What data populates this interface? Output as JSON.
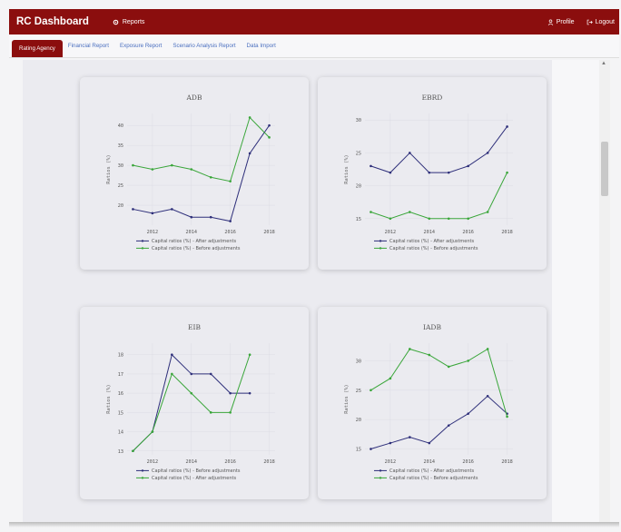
{
  "navbar": {
    "brand": "RC Dashboard",
    "reports_label": "Reports",
    "profile_label": "Profile",
    "logout_label": "Logout"
  },
  "tabs": [
    {
      "label": "Rating Agency",
      "active": true
    },
    {
      "label": "Financial Report",
      "active": false
    },
    {
      "label": "Exposure Report",
      "active": false
    },
    {
      "label": "Scenario Analysis Report",
      "active": false
    },
    {
      "label": "Data Import",
      "active": false
    }
  ],
  "colors": {
    "brand": "#8b0e0e",
    "series_dark": "#2e2f7a",
    "series_green": "#3aa63a",
    "tab_link": "#4a6fbf"
  },
  "chart_data": [
    {
      "type": "line",
      "title": "ADB",
      "ylabel": "Ratios (%)",
      "x": [
        2011,
        2012,
        2013,
        2014,
        2015,
        2016,
        2017,
        2018
      ],
      "xticks": [
        2012,
        2014,
        2016,
        2018
      ],
      "yticks": [
        20,
        25,
        30,
        35,
        40
      ],
      "ylim": [
        15,
        43
      ],
      "xlim": [
        2010.7,
        2018.3
      ],
      "series": [
        {
          "name": "Capital ratios (%) - After adjustments",
          "color": "#2e2f7a",
          "values": [
            19,
            18,
            19,
            17,
            17,
            16,
            33,
            40
          ]
        },
        {
          "name": "Capital ratios (%) - Before adjustments",
          "color": "#3aa63a",
          "values": [
            30,
            29,
            30,
            29,
            27,
            26,
            42,
            37
          ]
        }
      ]
    },
    {
      "type": "line",
      "title": "EBRD",
      "ylabel": "Ratios (%)",
      "x": [
        2011,
        2012,
        2013,
        2014,
        2015,
        2016,
        2017,
        2018
      ],
      "xticks": [
        2012,
        2014,
        2016,
        2018
      ],
      "yticks": [
        15,
        20,
        25,
        30
      ],
      "ylim": [
        14,
        31
      ],
      "xlim": [
        2010.7,
        2018.3
      ],
      "series": [
        {
          "name": "Capital ratios (%) - After adjustments",
          "color": "#2e2f7a",
          "values": [
            23,
            22,
            25,
            22,
            22,
            23,
            25,
            29
          ]
        },
        {
          "name": "Capital ratios (%) - Before adjustments",
          "color": "#3aa63a",
          "values": [
            16,
            15,
            16,
            15,
            15,
            15,
            16,
            22
          ]
        }
      ]
    },
    {
      "type": "line",
      "title": "EIB",
      "ylabel": "Ratios (%)",
      "x": [
        2011,
        2012,
        2013,
        2014,
        2015,
        2016,
        2017
      ],
      "xticks": [
        2012,
        2014,
        2016,
        2018
      ],
      "yticks": [
        13,
        14,
        15,
        16,
        17,
        18
      ],
      "ylim": [
        12.8,
        18.6
      ],
      "xlim": [
        2010.7,
        2018.3
      ],
      "series": [
        {
          "name": "Capital ratios (%) - Before adjustments",
          "color": "#2e2f7a",
          "values": [
            13,
            14,
            18,
            17,
            17,
            16,
            16
          ]
        },
        {
          "name": "Capital ratios (%) - After adjustments",
          "color": "#3aa63a",
          "values": [
            13,
            14,
            17,
            16,
            15,
            15,
            18
          ]
        }
      ]
    },
    {
      "type": "line",
      "title": "IADB",
      "ylabel": "Ratios (%)",
      "x": [
        2011,
        2012,
        2013,
        2014,
        2015,
        2016,
        2017,
        2018
      ],
      "xticks": [
        2012,
        2014,
        2016,
        2018
      ],
      "yticks": [
        15,
        20,
        25,
        30
      ],
      "ylim": [
        14,
        33
      ],
      "xlim": [
        2010.7,
        2018.3
      ],
      "series": [
        {
          "name": "Capital ratios (%) - After adjustments",
          "color": "#2e2f7a",
          "values": [
            15,
            16,
            17,
            16,
            19,
            21,
            24,
            21
          ]
        },
        {
          "name": "Capital ratios (%) - Before adjustments",
          "color": "#3aa63a",
          "values": [
            25,
            27,
            32,
            31,
            29,
            30,
            32,
            20.5
          ]
        }
      ]
    }
  ]
}
